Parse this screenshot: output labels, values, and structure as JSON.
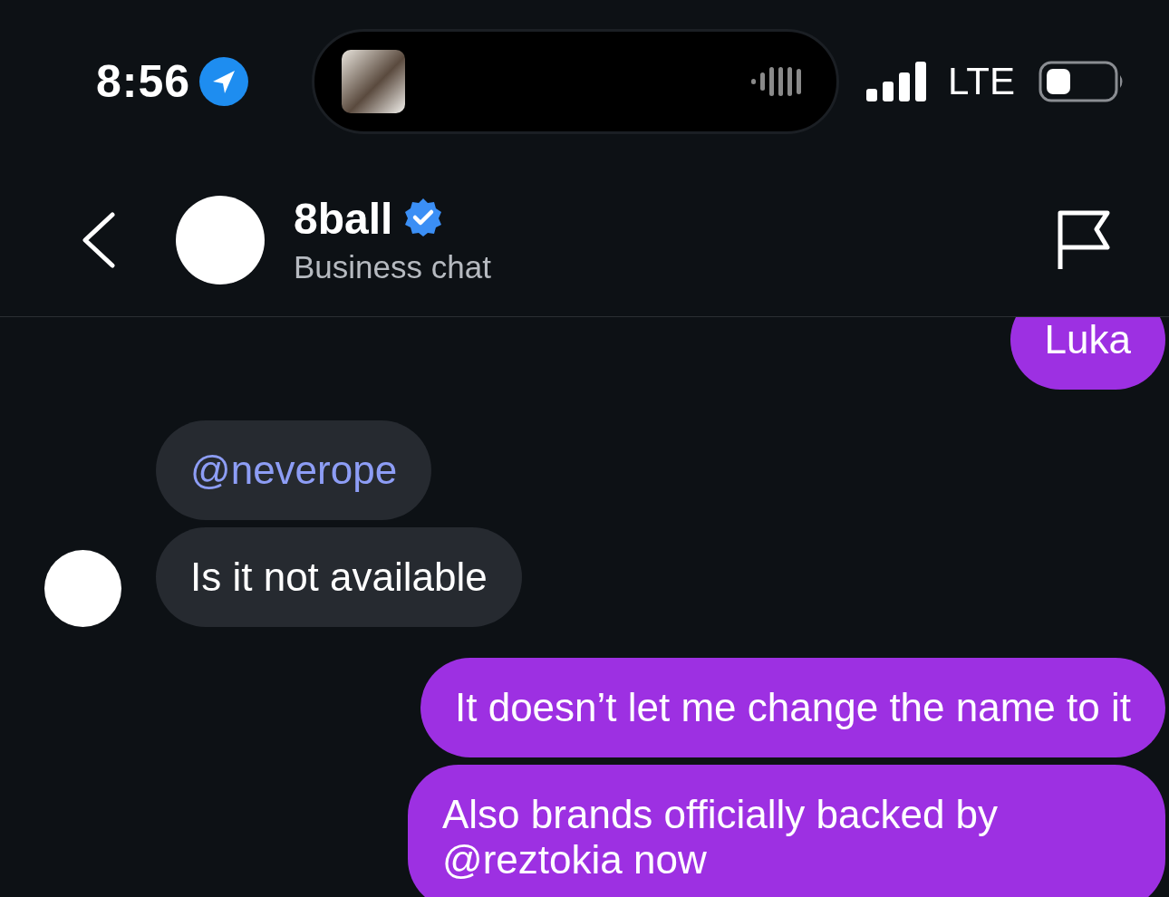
{
  "status_bar": {
    "time": "8:56",
    "network": "LTE"
  },
  "header": {
    "name": "8ball",
    "verified": true,
    "subtitle": "Business chat"
  },
  "messages": [
    {
      "kind": "outgoing",
      "text": "Luka",
      "mention": false,
      "show_avatar": false
    },
    {
      "kind": "incoming",
      "text": "@neverope",
      "mention": true,
      "show_avatar": false
    },
    {
      "kind": "incoming",
      "text": "Is it not available",
      "mention": false,
      "show_avatar": true
    },
    {
      "kind": "outgoing",
      "text": "It doesn’t let me change the name to it",
      "mention": false,
      "show_avatar": false
    },
    {
      "kind": "outgoing",
      "text": "Also brands officially backed by @reztokia now",
      "mention": false,
      "show_avatar": false
    }
  ]
}
